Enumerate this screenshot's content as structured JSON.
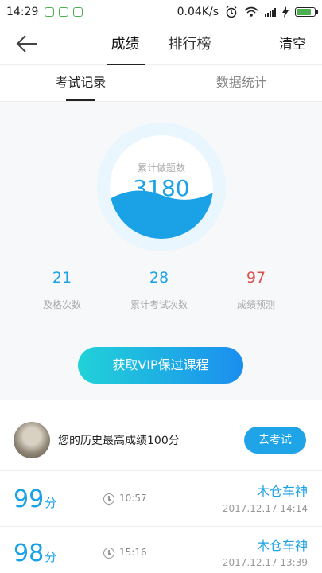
{
  "status_bar": {
    "time": "14:29",
    "speed": "0.04K/s",
    "icons": [
      "alarm-icon",
      "wifi-icon",
      "signal-icon",
      "bolt-icon",
      "battery-icon"
    ],
    "battery_level_pct": 70
  },
  "top_nav": {
    "back_icon": "arrow-left-icon",
    "tabs": [
      {
        "label": "成绩",
        "active": true
      },
      {
        "label": "排行榜",
        "active": false
      }
    ],
    "clear_label": "清空"
  },
  "sub_tabs": [
    {
      "label": "考试记录",
      "active": true
    },
    {
      "label": "数据统计",
      "active": false
    }
  ],
  "summary": {
    "total_label": "累计做题数",
    "total_value": "3180",
    "metrics": [
      {
        "value": "21",
        "label": "及格次数"
      },
      {
        "value": "28",
        "label": "累计考试次数"
      },
      {
        "value": "97",
        "label": "成绩预测"
      }
    ],
    "vip_button": "获取VIP保过课程"
  },
  "best": {
    "text": "您的历史最高成绩100分",
    "button": "去考试"
  },
  "records": [
    {
      "score": "99",
      "unit": "分",
      "time": "10:57",
      "name": "木仓车神",
      "date": "2017.12.17  14:14"
    },
    {
      "score": "98",
      "unit": "分",
      "time": "15:16",
      "name": "木仓车神",
      "date": "2017.12.17  13:39"
    }
  ],
  "colors": {
    "accent": "#1ba2e6",
    "warning": "#e0504d",
    "gradient_start": "#21d2d7",
    "gradient_end": "#1b8ef0"
  }
}
